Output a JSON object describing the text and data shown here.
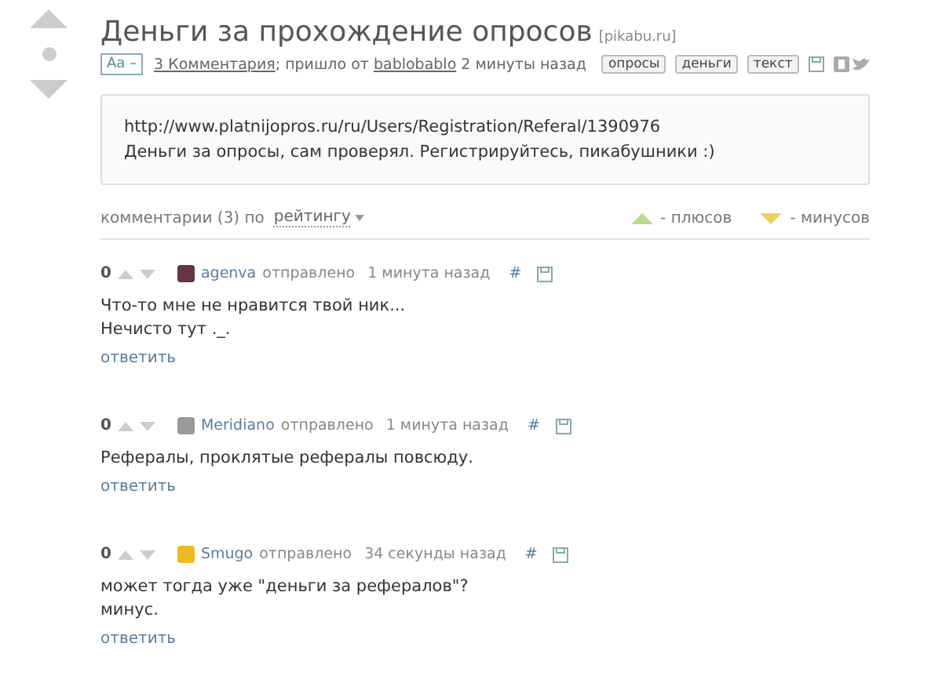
{
  "post": {
    "title": "Деньги за прохождение опросов",
    "source": "[pikabu.ru]",
    "font_toggle": "Aa –",
    "comments_link": "3 Комментария",
    "meta_text": "; пришло от",
    "author": "bablobablo",
    "time": "2 минуты назад",
    "tags": [
      "опросы",
      "деньги",
      "текст"
    ],
    "body": [
      "http://www.platnijopros.ru/ru/Users/Registration/Referal/1390976",
      "Деньги за опросы, сам проверял. Регистрируйтесь, пикабушники :)"
    ]
  },
  "sort_bar": {
    "label": "комментарии (3) по",
    "sort": "рейтингу",
    "plus_legend": "-  плюсов",
    "minus_legend": "-  минусов"
  },
  "comments": [
    {
      "score": "0",
      "author": "agenva",
      "sent": "отправлено",
      "time": "1 минута назад",
      "hash": "#",
      "lines": [
        "Что-то мне не нравится твой ник...",
        "Нечисто тут ._."
      ],
      "reply": "ответить"
    },
    {
      "score": "0",
      "author": "Meridiano",
      "sent": "отправлено",
      "time": "1 минута назад",
      "hash": "#",
      "lines": [
        "Рефералы, проклятые рефералы повсюду."
      ],
      "reply": "ответить"
    },
    {
      "score": "0",
      "author": "Smugo",
      "sent": "отправлено",
      "time": "34 секунды назад",
      "hash": "#",
      "lines": [
        "может тогда уже \"деньги за рефералов\"?",
        "минус."
      ],
      "reply": "ответить"
    }
  ]
}
